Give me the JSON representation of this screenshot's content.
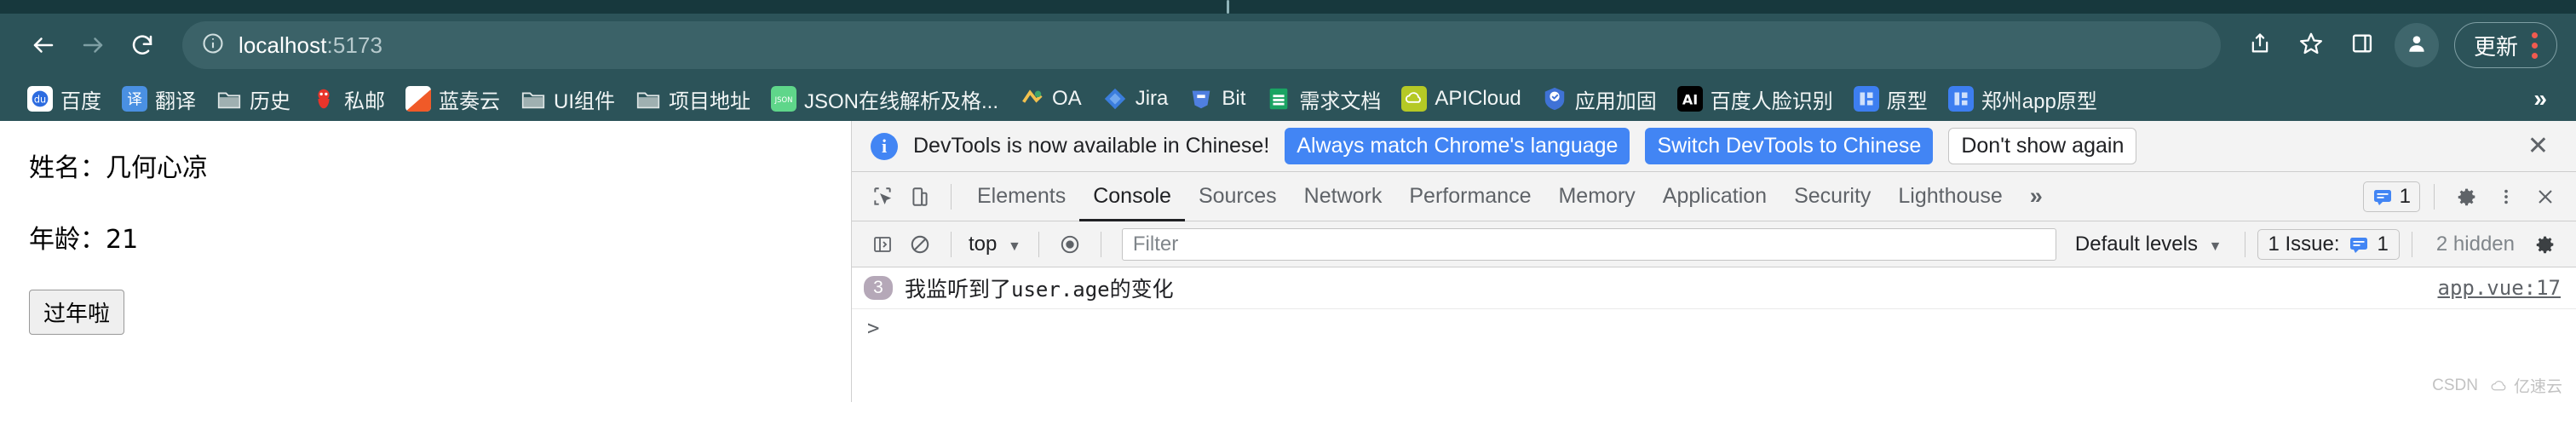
{
  "browser": {
    "nav": {
      "back_icon": "arrow-left-icon",
      "forward_icon": "arrow-right-icon",
      "reload_icon": "reload-icon"
    },
    "omnibox": {
      "site_info_icon": "info-circle-icon",
      "host": "localhost",
      "port": ":5173",
      "full_url": "localhost:5173"
    },
    "toolbar_right": {
      "share_icon": "share-icon",
      "bookmark_icon": "star-icon",
      "side_panel_icon": "side-panel-icon",
      "profile_icon": "avatar-icon",
      "update_label": "更新",
      "menu_icon": "kebab-menu-icon"
    },
    "bookmarks": [
      {
        "label": "百度",
        "icon": "baidu-icon"
      },
      {
        "label": "翻译",
        "icon": "translate-icon"
      },
      {
        "label": "历史",
        "icon": "folder-icon"
      },
      {
        "label": "私邮",
        "icon": "mail-icon"
      },
      {
        "label": "蓝奏云",
        "icon": "lanzou-icon"
      },
      {
        "label": "UI组件",
        "icon": "folder-icon"
      },
      {
        "label": "项目地址",
        "icon": "folder-icon"
      },
      {
        "label": "JSON在线解析及格...",
        "icon": "json-icon"
      },
      {
        "label": "OA",
        "icon": "oa-icon"
      },
      {
        "label": "Jira",
        "icon": "jira-icon"
      },
      {
        "label": "Bit",
        "icon": "bit-icon"
      },
      {
        "label": "需求文档",
        "icon": "sheets-icon"
      },
      {
        "label": "APICloud",
        "icon": "apicloud-icon"
      },
      {
        "label": "应用加固",
        "icon": "shield-icon"
      },
      {
        "label": "百度人脸识别",
        "icon": "ai-icon"
      },
      {
        "label": "原型",
        "icon": "prototype-icon"
      },
      {
        "label": "郑州app原型",
        "icon": "prototype-icon"
      }
    ],
    "bookmarks_overflow": "»"
  },
  "page": {
    "name_line": "姓名：几何心凉",
    "age_line": "年龄：21",
    "button_label": "过年啦"
  },
  "devtools": {
    "banner": {
      "info_icon": "info-icon",
      "message": "DevTools is now available in Chinese!",
      "primary_button": "Always match Chrome's language",
      "secondary_button": "Switch DevTools to Chinese",
      "dismiss_button": "Don't show again",
      "close_icon": "close-icon"
    },
    "tools": {
      "inspect_icon": "inspect-element-icon",
      "device_icon": "device-toolbar-icon"
    },
    "tabs": [
      {
        "label": "Elements",
        "active": false
      },
      {
        "label": "Console",
        "active": true
      },
      {
        "label": "Sources",
        "active": false
      },
      {
        "label": "Network",
        "active": false
      },
      {
        "label": "Performance",
        "active": false
      },
      {
        "label": "Memory",
        "active": false
      },
      {
        "label": "Application",
        "active": false
      },
      {
        "label": "Security",
        "active": false
      },
      {
        "label": "Lighthouse",
        "active": false
      }
    ],
    "tabs_overflow": "»",
    "tabs_right": {
      "message_icon": "message-badge-icon",
      "message_count": "1",
      "settings_icon": "gear-icon",
      "more_icon": "kebab-menu-icon",
      "close_icon": "close-icon"
    },
    "filterbar": {
      "sidebar_icon": "console-sidebar-icon",
      "clear_icon": "clear-console-icon",
      "context": "top",
      "context_caret": "▼",
      "eye_icon": "live-expression-icon",
      "filter_placeholder": "Filter",
      "filter_value": "",
      "levels_label": "Default levels",
      "levels_caret": "▼",
      "issue_label": "1 Issue:",
      "issue_icon": "message-badge-icon",
      "issue_count": "1",
      "hidden_label": "2 hidden",
      "settings_icon": "gear-icon"
    },
    "console": {
      "messages": [
        {
          "count": "3",
          "text_prefix": "我监听到了",
          "text_mono": "user.age",
          "text_suffix": "的变化",
          "source": "app.vue:17"
        }
      ],
      "prompt_caret": ">"
    }
  },
  "watermark": {
    "left": "CSDN",
    "right": "亿速云"
  },
  "colors": {
    "chrome_bg": "#2c5359",
    "tabstrip_bg": "#17383d",
    "omnibox_bg": "#3b6268",
    "accent_blue": "#4285f4",
    "devtools_bg": "#f3f3f3",
    "update_dot": "#f05a4f"
  }
}
